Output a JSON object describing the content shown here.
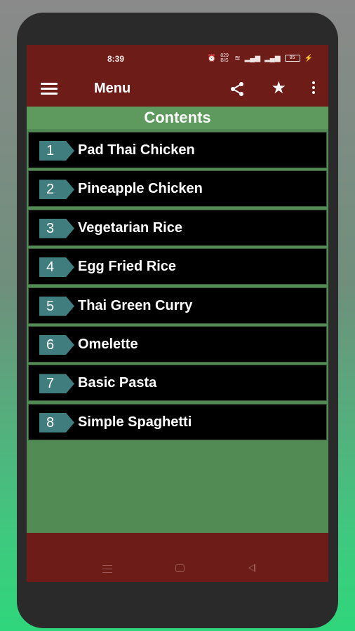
{
  "status_bar": {
    "time": "8:39",
    "net_speed": "829 B/S",
    "battery": "85"
  },
  "app_bar": {
    "menu_icon": "hamburger-icon",
    "title": "Menu",
    "share_icon": "share-icon",
    "star_icon": "star-icon",
    "more_icon": "more-vert-icon"
  },
  "contents": {
    "heading": "Contents",
    "items": [
      {
        "number": "1",
        "title": "Pad Thai Chicken"
      },
      {
        "number": "2",
        "title": "Pineapple Chicken"
      },
      {
        "number": "3",
        "title": "Vegetarian Rice"
      },
      {
        "number": "4",
        "title": "Egg Fried Rice"
      },
      {
        "number": "5",
        "title": "Thai Green Curry"
      },
      {
        "number": "6",
        "title": "Omelette"
      },
      {
        "number": "7",
        "title": "Basic Pasta"
      },
      {
        "number": "8",
        "title": "Simple Spaghetti"
      }
    ]
  },
  "colors": {
    "bar": "#6e1c18",
    "content_bg": "#528b53",
    "header_bg": "#5e9a5d",
    "item_bg": "#000000",
    "badge": "#3f7d7e"
  },
  "nav_bar": {
    "recents_icon": "recents-icon",
    "home_icon": "home-icon",
    "back_icon": "back-icon"
  }
}
